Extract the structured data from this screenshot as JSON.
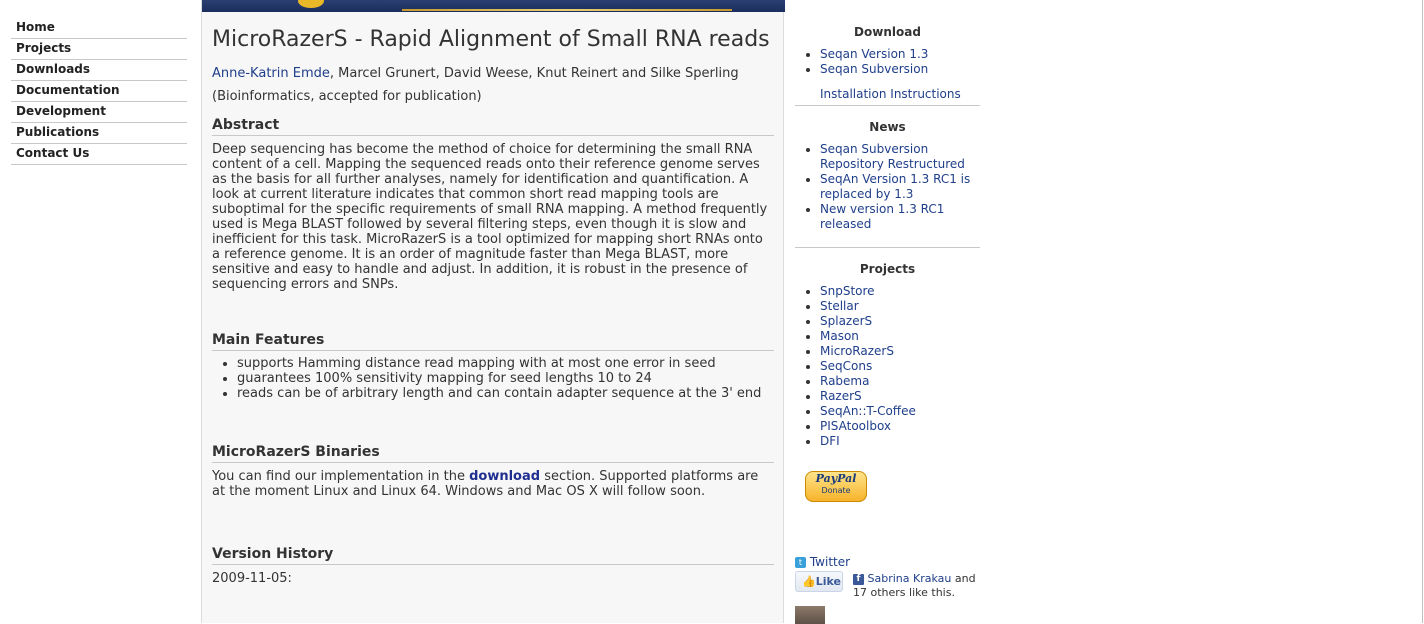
{
  "nav": {
    "items": [
      {
        "label": "Home"
      },
      {
        "label": "Projects"
      },
      {
        "label": "Downloads"
      },
      {
        "label": "Documentation"
      },
      {
        "label": "Development"
      },
      {
        "label": "Publications"
      },
      {
        "label": "Contact Us"
      }
    ]
  },
  "main": {
    "title": "MicroRazerS - Rapid Alignment of Small RNA reads",
    "authors_first": "Anne-Katrin Emde",
    "authors_rest": ", Marcel Grunert, David Weese, Knut Reinert and Silke Sperling",
    "venue": "(Bioinformatics, accepted for publication)",
    "abstract_heading": "Abstract",
    "abstract_text": "Deep sequencing has become the method of choice for determining the small RNA content of a cell. Mapping the sequenced reads onto their reference genome serves as the basis for all further analyses, namely for identification and quantification. A look at current literature indicates that common short read mapping tools are suboptimal for the specific requirements of small RNA mapping. A method frequently used is Mega BLAST followed by several filtering steps, even though it is slow and inefficient for this task. MicroRazerS is a tool optimized for mapping short RNAs onto a reference genome. It is an order of magnitude faster than Mega BLAST, more sensitive and easy to handle and adjust. In addition, it is robust in the presence of sequencing errors and SNPs.",
    "features_heading": "Main Features",
    "features": [
      "supports Hamming distance read mapping with at most one error in seed",
      "guarantees 100% sensitivity mapping for seed lengths 10 to 24",
      "reads can be of arbitrary length and can contain adapter sequence at the 3' end"
    ],
    "binaries_heading": "MicroRazerS Binaries",
    "binaries_pre": "You can find our implementation in the ",
    "binaries_link": "download",
    "binaries_post": " section. Supported platforms are at the moment Linux and Linux 64. Windows and Mac OS X will follow soon.",
    "history_heading": "Version History",
    "history_first": "2009-11-05:"
  },
  "right": {
    "download_title": "Download",
    "download_links": [
      "Seqan Version 1.3",
      "Seqan Subversion"
    ],
    "install_link": "Installation Instructions",
    "news_title": "News",
    "news": [
      "Seqan Subversion Repository Restructured",
      "SeqAn Version 1.3 RC1 is replaced by 1.3",
      "New version 1.3 RC1 released"
    ],
    "projects_title": "Projects",
    "projects": [
      "SnpStore",
      "Stellar",
      "SplazerS",
      "Mason",
      "MicroRazerS",
      "SeqCons",
      "Rabema",
      "RazerS",
      "SeqAn::T-Coffee",
      "PISAtoolbox",
      "DFI"
    ],
    "paypal_logo": "PayPal",
    "paypal_label": "Donate",
    "twitter_label": "Twitter",
    "like_label": "Like",
    "fb_name": "Sabrina Krakau",
    "fb_rest": " and 17 others like this."
  }
}
